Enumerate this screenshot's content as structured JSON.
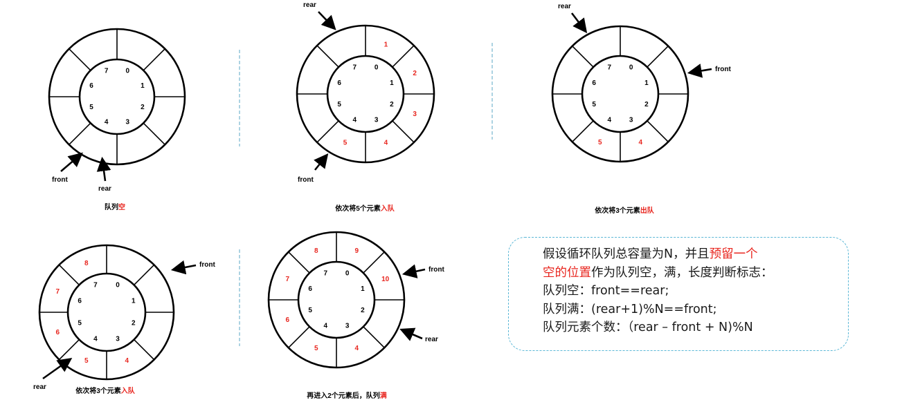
{
  "colors": {
    "highlight": "#e8261f",
    "ink": "#000000",
    "note_border": "#5ab7d6"
  },
  "labels": {
    "front": "front",
    "rear": "rear"
  },
  "slot_indices": [
    "0",
    "1",
    "2",
    "3",
    "4",
    "5",
    "6",
    "7"
  ],
  "diagrams": [
    {
      "id": "empty",
      "caption_pre": "队列",
      "caption_hl": "空",
      "caption_post": "",
      "values": [
        "",
        "",
        "",
        "",
        "",
        "",
        "",
        ""
      ]
    },
    {
      "id": "enqueue5",
      "caption_pre": "依次将5个元素",
      "caption_hl": "入队",
      "caption_post": "",
      "values": [
        "1",
        "2",
        "3",
        "4",
        "5",
        "",
        "",
        ""
      ]
    },
    {
      "id": "dequeue3",
      "caption_pre": "依次将3个元素",
      "caption_hl": "出队",
      "caption_post": "",
      "values": [
        "",
        "",
        "",
        "4",
        "5",
        "",
        "",
        ""
      ]
    },
    {
      "id": "enqueue3",
      "caption_pre": "依次将3个元素",
      "caption_hl": "入队",
      "caption_post": "",
      "values": [
        "",
        "",
        "",
        "4",
        "5",
        "6",
        "7",
        "8"
      ]
    },
    {
      "id": "full",
      "caption_pre": "再进入2个元素后，队列",
      "caption_hl": "满",
      "caption_post": "",
      "values": [
        "9",
        "10",
        "",
        "4",
        "5",
        "6",
        "7",
        "8"
      ]
    }
  ],
  "note": {
    "line1_pre": "假设循环队列总容量为N，并且",
    "line1_hl": "预留一个",
    "line2_hl": "空的位置",
    "line2_post": "作为队列空，满，长度判断标志：",
    "line3": "队列空：front==rear;",
    "line4": "队列满：(rear+1)%N==front;",
    "line5": "队列元素个数：（rear – front + N)%N"
  }
}
